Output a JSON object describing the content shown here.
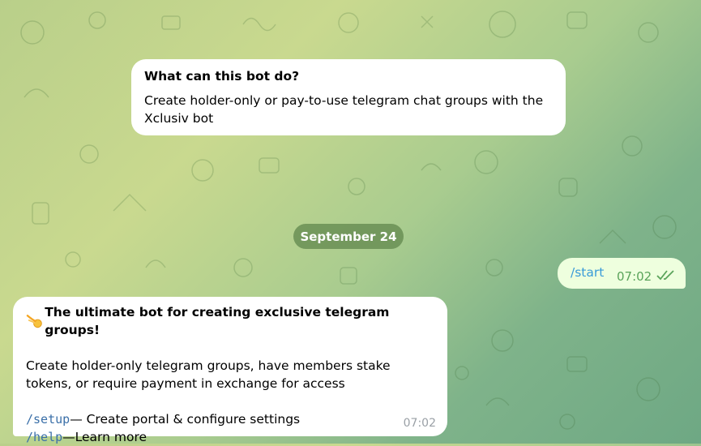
{
  "intro_card": {
    "title": "What can this bot do?",
    "description": "Create holder-only or pay-to-use telegram chat groups with the Xclusiv bot"
  },
  "date_separator": "September 24",
  "outgoing_message": {
    "text": "/start",
    "time": "07:02",
    "status_icon": "double-check-icon"
  },
  "bot_message": {
    "headline_icon": "comet-icon",
    "headline": "The ultimate bot for creating exclusive telegram groups!",
    "paragraph": "Create holder-only telegram groups, have members stake tokens, or require payment in exchange for access",
    "commands": [
      {
        "command": "/setup",
        "description": "— Create portal & configure settings"
      },
      {
        "command": "/help",
        "description": "—Learn more"
      }
    ],
    "time": "07:02"
  },
  "colors": {
    "bubble_in": "#ffffff",
    "bubble_out": "#eeffde",
    "link": "#3a9bd8",
    "date_pill": "#678c52"
  }
}
